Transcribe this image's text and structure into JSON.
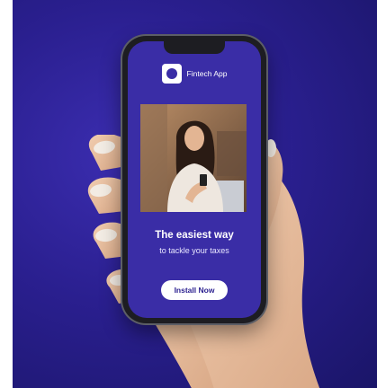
{
  "app": {
    "name": "Fintech App",
    "logo_icon": "app-logo-icon"
  },
  "content": {
    "headline": "The easiest way",
    "subline": "to tackle your taxes",
    "cta_label": "Install Now"
  },
  "colors": {
    "background": "#2a1f8f",
    "screen": "#3a2da6",
    "button_bg": "#ffffff",
    "button_text": "#2a1f8f"
  }
}
